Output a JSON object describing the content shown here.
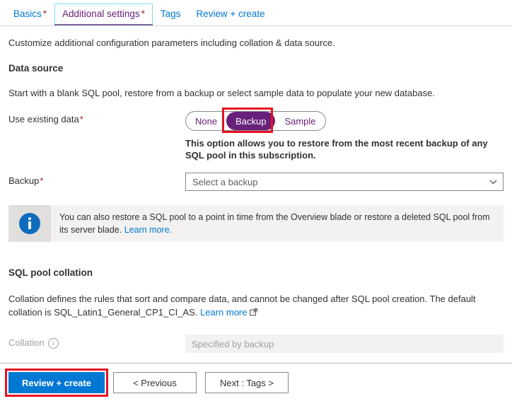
{
  "tabs": [
    {
      "label": "Basics",
      "required": "*",
      "active": false
    },
    {
      "label": "Additional settings",
      "required": "*",
      "active": true
    },
    {
      "label": "Tags",
      "required": "",
      "active": false
    },
    {
      "label": "Review + create",
      "required": "",
      "active": false
    }
  ],
  "intro": "Customize additional configuration parameters including collation & data source.",
  "data_source": {
    "heading": "Data source",
    "description": "Start with a blank SQL pool, restore from a backup or select sample data to populate your new database.",
    "use_existing_data": {
      "label": "Use existing data",
      "required": "*",
      "options": [
        "None",
        "Backup",
        "Sample"
      ],
      "selected": "Backup",
      "option_description": "This option allows you to restore from the most recent backup of any SQL pool in this subscription."
    },
    "backup": {
      "label": "Backup",
      "required": "*",
      "placeholder": "Select a backup",
      "value": "Select a backup",
      "chevron_icon": "chevron-down-icon"
    },
    "info_banner": {
      "icon": "info-icon",
      "text": "You can also restore a SQL pool to a point in time from the Overview blade or restore a deleted SQL pool from its server blade.",
      "link_text": "Learn more."
    }
  },
  "collation_section": {
    "heading": "SQL pool collation",
    "description_part1": "Collation defines the rules that sort and compare data, and cannot be changed after SQL pool creation. The default collation is SQL_Latin1_General_CP1_CI_AS.",
    "link_text": "Learn more",
    "link_icon": "external-link-icon",
    "field": {
      "label": "Collation",
      "info_icon": "info-circle-icon",
      "value": "Specified by backup",
      "disabled": true
    }
  },
  "footer": {
    "review_create": "Review + create",
    "previous": "< Previous",
    "next": "Next : Tags >"
  },
  "colors": {
    "accent_blue": "#0078d4",
    "purple": "#68217a",
    "highlight_red": "#e81123",
    "required_red": "#a4262c",
    "tab_underline": "#a4508b",
    "banner_bg": "#f3f2f1",
    "banner_icon_bg": "#e1dfdd",
    "info_icon_blue": "#0f6cbd"
  }
}
